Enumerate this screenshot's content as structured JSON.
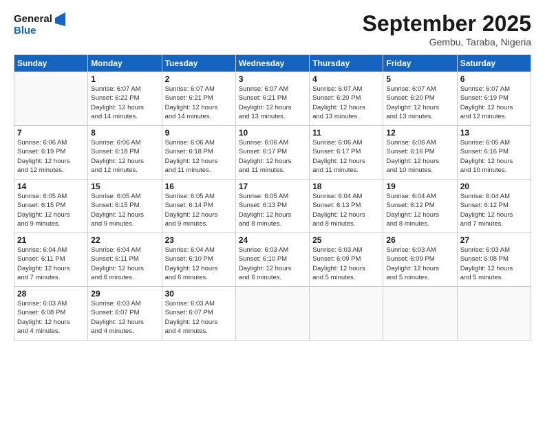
{
  "header": {
    "logo_general": "General",
    "logo_blue": "Blue",
    "month_title": "September 2025",
    "subtitle": "Gembu, Taraba, Nigeria"
  },
  "days_of_week": [
    "Sunday",
    "Monday",
    "Tuesday",
    "Wednesday",
    "Thursday",
    "Friday",
    "Saturday"
  ],
  "weeks": [
    [
      {
        "day": "",
        "info": ""
      },
      {
        "day": "1",
        "info": "Sunrise: 6:07 AM\nSunset: 6:22 PM\nDaylight: 12 hours\nand 14 minutes."
      },
      {
        "day": "2",
        "info": "Sunrise: 6:07 AM\nSunset: 6:21 PM\nDaylight: 12 hours\nand 14 minutes."
      },
      {
        "day": "3",
        "info": "Sunrise: 6:07 AM\nSunset: 6:21 PM\nDaylight: 12 hours\nand 13 minutes."
      },
      {
        "day": "4",
        "info": "Sunrise: 6:07 AM\nSunset: 6:20 PM\nDaylight: 12 hours\nand 13 minutes."
      },
      {
        "day": "5",
        "info": "Sunrise: 6:07 AM\nSunset: 6:20 PM\nDaylight: 12 hours\nand 13 minutes."
      },
      {
        "day": "6",
        "info": "Sunrise: 6:07 AM\nSunset: 6:19 PM\nDaylight: 12 hours\nand 12 minutes."
      }
    ],
    [
      {
        "day": "7",
        "info": "Sunrise: 6:06 AM\nSunset: 6:19 PM\nDaylight: 12 hours\nand 12 minutes."
      },
      {
        "day": "8",
        "info": "Sunrise: 6:06 AM\nSunset: 6:18 PM\nDaylight: 12 hours\nand 12 minutes."
      },
      {
        "day": "9",
        "info": "Sunrise: 6:06 AM\nSunset: 6:18 PM\nDaylight: 12 hours\nand 11 minutes."
      },
      {
        "day": "10",
        "info": "Sunrise: 6:06 AM\nSunset: 6:17 PM\nDaylight: 12 hours\nand 11 minutes."
      },
      {
        "day": "11",
        "info": "Sunrise: 6:06 AM\nSunset: 6:17 PM\nDaylight: 12 hours\nand 11 minutes."
      },
      {
        "day": "12",
        "info": "Sunrise: 6:06 AM\nSunset: 6:16 PM\nDaylight: 12 hours\nand 10 minutes."
      },
      {
        "day": "13",
        "info": "Sunrise: 6:05 AM\nSunset: 6:16 PM\nDaylight: 12 hours\nand 10 minutes."
      }
    ],
    [
      {
        "day": "14",
        "info": "Sunrise: 6:05 AM\nSunset: 6:15 PM\nDaylight: 12 hours\nand 9 minutes."
      },
      {
        "day": "15",
        "info": "Sunrise: 6:05 AM\nSunset: 6:15 PM\nDaylight: 12 hours\nand 9 minutes."
      },
      {
        "day": "16",
        "info": "Sunrise: 6:05 AM\nSunset: 6:14 PM\nDaylight: 12 hours\nand 9 minutes."
      },
      {
        "day": "17",
        "info": "Sunrise: 6:05 AM\nSunset: 6:13 PM\nDaylight: 12 hours\nand 8 minutes."
      },
      {
        "day": "18",
        "info": "Sunrise: 6:04 AM\nSunset: 6:13 PM\nDaylight: 12 hours\nand 8 minutes."
      },
      {
        "day": "19",
        "info": "Sunrise: 6:04 AM\nSunset: 6:12 PM\nDaylight: 12 hours\nand 8 minutes."
      },
      {
        "day": "20",
        "info": "Sunrise: 6:04 AM\nSunset: 6:12 PM\nDaylight: 12 hours\nand 7 minutes."
      }
    ],
    [
      {
        "day": "21",
        "info": "Sunrise: 6:04 AM\nSunset: 6:11 PM\nDaylight: 12 hours\nand 7 minutes."
      },
      {
        "day": "22",
        "info": "Sunrise: 6:04 AM\nSunset: 6:11 PM\nDaylight: 12 hours\nand 6 minutes."
      },
      {
        "day": "23",
        "info": "Sunrise: 6:04 AM\nSunset: 6:10 PM\nDaylight: 12 hours\nand 6 minutes."
      },
      {
        "day": "24",
        "info": "Sunrise: 6:03 AM\nSunset: 6:10 PM\nDaylight: 12 hours\nand 6 minutes."
      },
      {
        "day": "25",
        "info": "Sunrise: 6:03 AM\nSunset: 6:09 PM\nDaylight: 12 hours\nand 5 minutes."
      },
      {
        "day": "26",
        "info": "Sunrise: 6:03 AM\nSunset: 6:09 PM\nDaylight: 12 hours\nand 5 minutes."
      },
      {
        "day": "27",
        "info": "Sunrise: 6:03 AM\nSunset: 6:08 PM\nDaylight: 12 hours\nand 5 minutes."
      }
    ],
    [
      {
        "day": "28",
        "info": "Sunrise: 6:03 AM\nSunset: 6:08 PM\nDaylight: 12 hours\nand 4 minutes."
      },
      {
        "day": "29",
        "info": "Sunrise: 6:03 AM\nSunset: 6:07 PM\nDaylight: 12 hours\nand 4 minutes."
      },
      {
        "day": "30",
        "info": "Sunrise: 6:03 AM\nSunset: 6:07 PM\nDaylight: 12 hours\nand 4 minutes."
      },
      {
        "day": "",
        "info": ""
      },
      {
        "day": "",
        "info": ""
      },
      {
        "day": "",
        "info": ""
      },
      {
        "day": "",
        "info": ""
      }
    ]
  ]
}
